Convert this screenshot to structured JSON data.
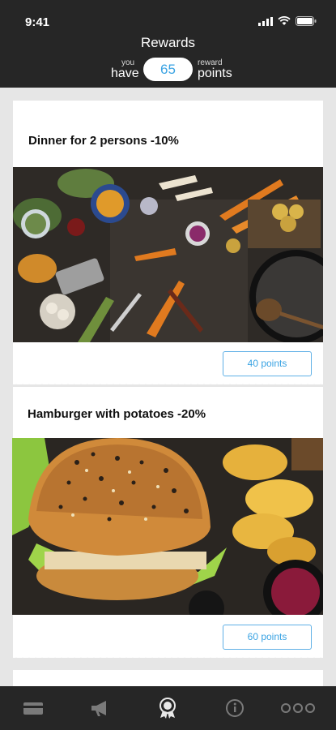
{
  "status": {
    "time": "9:41"
  },
  "header": {
    "title": "Rewards",
    "you_label": "you",
    "have_label": "have",
    "points_value": "65",
    "reward_label": "reward",
    "points_label": "points"
  },
  "rewards": [
    {
      "title": "Dinner for 2 persons -10%",
      "points_label": "40 points",
      "image": "vegetables-on-table-photo"
    },
    {
      "title": "Hamburger with potatoes -20%",
      "points_label": "60 points",
      "image": "burger-with-potatoes-photo"
    }
  ],
  "tabbar": {
    "items": [
      {
        "icon": "card-icon"
      },
      {
        "icon": "megaphone-icon"
      },
      {
        "icon": "award-icon",
        "active": true
      },
      {
        "icon": "info-icon"
      },
      {
        "icon": "more-icon"
      }
    ]
  },
  "colors": {
    "header_bg": "#262626",
    "accent": "#3aa3e3",
    "background": "#e6e6e6"
  }
}
